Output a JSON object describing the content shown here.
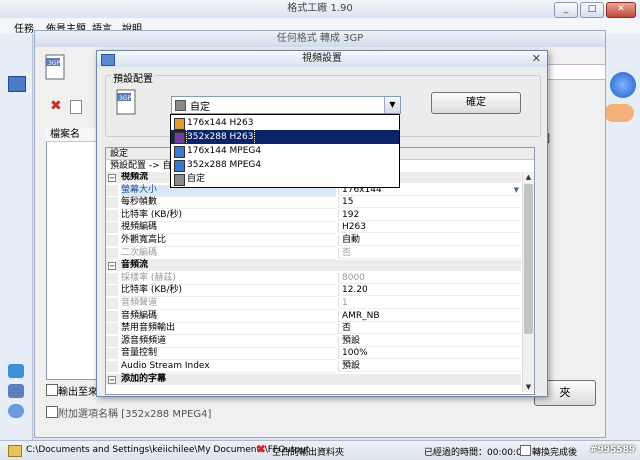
{
  "outer": {
    "title": "格式工廠 1.90",
    "menus": [
      "任務",
      "佈景主題",
      "語言",
      "說明"
    ]
  },
  "mid": {
    "title": "任何格式 轉成 3GP",
    "list_header": "檔案名",
    "right_partial_label": "K",
    "right_partial_label2": "圍",
    "output_checkbox_label": "輸出至來",
    "append_checkbox_label": "附加選項名稱 [352x288 MPEG4]",
    "bottom_right_button": "夾"
  },
  "dialog": {
    "title": "視頻設置",
    "preset_group_label": "預設配置",
    "preset_selected": "自定",
    "ok_label": "確定",
    "dropdown_options": [
      "176x144 H263",
      "352x288 H263",
      "176x144 MPEG4",
      "352x288 MPEG4",
      "自定"
    ],
    "dropdown_highlighted": 1,
    "grid_header": "設定",
    "grid_path": "預設配置 -> 自",
    "rows": [
      {
        "type": "cat",
        "name": "視頻流"
      },
      {
        "type": "prop",
        "name": "螢幕大小",
        "value": "176x144",
        "highlight": true,
        "dropdown": true
      },
      {
        "type": "prop",
        "name": "每秒幀數",
        "value": "15"
      },
      {
        "type": "prop",
        "name": "比特率 (KB/秒)",
        "value": "192"
      },
      {
        "type": "prop",
        "name": "視頻編碼",
        "value": "H263"
      },
      {
        "type": "prop",
        "name": "外觀寬高比",
        "value": "自動"
      },
      {
        "type": "prop",
        "name": "二次編碼",
        "value": "否",
        "disabled": true
      },
      {
        "type": "cat",
        "name": "音頻流"
      },
      {
        "type": "prop",
        "name": "採樣率 (赫茲)",
        "value": "8000",
        "disabled": true
      },
      {
        "type": "prop",
        "name": "比特率 (KB/秒)",
        "value": "12.20"
      },
      {
        "type": "prop",
        "name": "音頻聲道",
        "value": "1",
        "disabled": true
      },
      {
        "type": "prop",
        "name": "音頻編碼",
        "value": "AMR_NB"
      },
      {
        "type": "prop",
        "name": "禁用音頻輸出",
        "value": "否"
      },
      {
        "type": "prop",
        "name": "源音頻頻道",
        "value": "預設"
      },
      {
        "type": "prop",
        "name": "音量控制",
        "value": "100%"
      },
      {
        "type": "prop",
        "name": "Audio Stream Index",
        "value": "預設"
      },
      {
        "type": "cat",
        "name": "添加的字幕"
      }
    ]
  },
  "statusbar": {
    "path": "C:\\Documents and Settings\\keiichilee\\My Documents\\FFOutput",
    "empty_folder": "空白的輸出資料夾",
    "elapsed": "已經過的時間：00:00:00",
    "after_complete": "轉換完成後",
    "watermark": "#995589"
  },
  "colors": {
    "selection": "#0a246a",
    "window_border": "#6f86ad"
  }
}
